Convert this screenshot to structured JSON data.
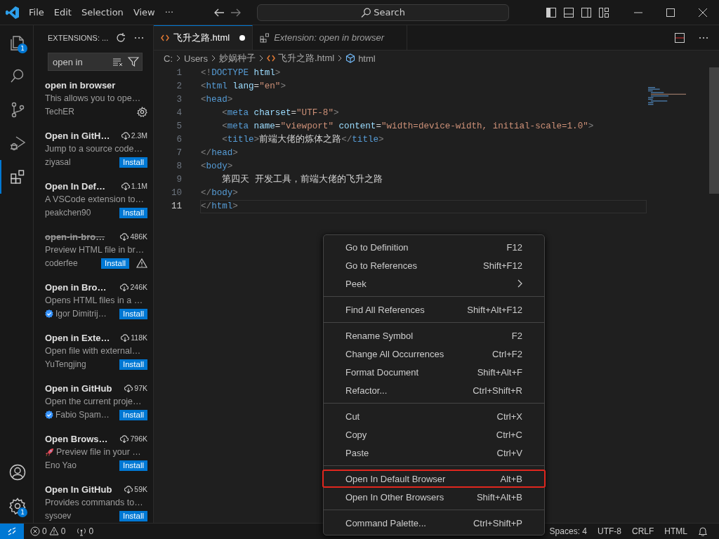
{
  "titlebar": {
    "menu": [
      "File",
      "Edit",
      "Selection",
      "View",
      "···"
    ],
    "search": "Search"
  },
  "activity_bar": {
    "top": [
      {
        "kind": "explorer",
        "selected": false,
        "badge": "1"
      },
      {
        "kind": "search",
        "selected": false
      },
      {
        "kind": "scm",
        "selected": false
      },
      {
        "kind": "run",
        "selected": false
      },
      {
        "kind": "extensions",
        "selected": true
      }
    ],
    "bottom": [
      {
        "kind": "accounts"
      },
      {
        "kind": "manage",
        "badge": "1"
      }
    ]
  },
  "sidebar": {
    "title": "EXTENSIONS: ...",
    "search": {
      "value": "open in"
    },
    "extensions": [
      {
        "name": "open in browser",
        "description": "This allows you to ope…",
        "publisher": "TechER",
        "verified": false,
        "deprecated": false,
        "kind": "installed",
        "warning": false
      },
      {
        "name": "Open in GitH…",
        "downloads": "2.3M",
        "description": "Jump to a source code…",
        "publisher": "ziyasal",
        "verified": false,
        "deprecated": false,
        "kind": "available",
        "action_label": "Install",
        "warning": false
      },
      {
        "name": "Open In Def…",
        "downloads": "1.1M",
        "description": "A VSCode extension to…",
        "publisher": "peakchen90",
        "verified": false,
        "deprecated": false,
        "kind": "available",
        "action_label": "Install",
        "warning": false
      },
      {
        "name": "open-in-bro…",
        "downloads": "486K",
        "description": "Preview HTML file in br…",
        "publisher": "coderfee",
        "verified": false,
        "deprecated": true,
        "kind": "available",
        "action_label": "Install",
        "warning": true
      },
      {
        "name": "Open in Bro…",
        "downloads": "246K",
        "description": "Opens HTML files in a …",
        "publisher": "Igor Dimitrij…",
        "verified": true,
        "deprecated": false,
        "kind": "available",
        "action_label": "Install",
        "warning": false
      },
      {
        "name": "Open in Exte…",
        "downloads": "118K",
        "description": "Open file with external…",
        "publisher": "YuTengjing",
        "verified": false,
        "deprecated": false,
        "kind": "available",
        "action_label": "Install",
        "warning": false
      },
      {
        "name": "Open in GitHub",
        "downloads": "97K",
        "description": "Open the current proje…",
        "publisher": "Fabio Spam…",
        "verified": true,
        "deprecated": false,
        "kind": "available",
        "action_label": "Install",
        "warning": false
      },
      {
        "name": "Open Brows…",
        "downloads": "796K",
        "description": "Preview file in your …",
        "publisher": "Eno Yao",
        "verified": false,
        "deprecated": false,
        "kind": "available",
        "action_label": "Install",
        "warning": false
      },
      {
        "name": "Open In GitHub",
        "downloads": "59K",
        "description": "Provides commands to…",
        "publisher": "sysoev",
        "verified": false,
        "deprecated": false,
        "kind": "available",
        "action_label": "Install",
        "warning": false
      }
    ]
  },
  "tabs": [
    {
      "label": "飞升之路.html",
      "kind": "file",
      "selected": true,
      "modified": true,
      "preview": false
    },
    {
      "label": "Extension: open in browser",
      "kind": "extension",
      "selected": false,
      "modified": false,
      "preview": true
    }
  ],
  "breadcrumb": [
    {
      "label": "C:",
      "kind": "folder"
    },
    {
      "label": "Users",
      "kind": "folder"
    },
    {
      "label": "妙娲种子",
      "kind": "folder"
    },
    {
      "label": "飞升之路.html",
      "kind": "file"
    },
    {
      "label": "html",
      "kind": "element"
    }
  ],
  "code": [
    {
      "number": "1",
      "current": false,
      "tokens": [
        {
          "kind": "punct",
          "text": "<!"
        },
        {
          "kind": "tag",
          "text": "DOCTYPE"
        },
        {
          "kind": "attr",
          "text": " html"
        },
        {
          "kind": "punct",
          "text": ">"
        }
      ]
    },
    {
      "number": "2",
      "current": false,
      "tokens": [
        {
          "kind": "punct",
          "text": "<"
        },
        {
          "kind": "tag",
          "text": "html"
        },
        {
          "kind": "attr",
          "text": " lang"
        },
        {
          "kind": "plain",
          "text": "="
        },
        {
          "kind": "string",
          "text": "\"en\""
        },
        {
          "kind": "punct",
          "text": ">"
        }
      ]
    },
    {
      "number": "3",
      "current": false,
      "tokens": [
        {
          "kind": "punct",
          "text": "<"
        },
        {
          "kind": "tag",
          "text": "head"
        },
        {
          "kind": "punct",
          "text": ">"
        }
      ]
    },
    {
      "number": "4",
      "current": false,
      "tokens": [
        {
          "kind": "punct",
          "text": "    <"
        },
        {
          "kind": "tag",
          "text": "meta"
        },
        {
          "kind": "attr",
          "text": " charset"
        },
        {
          "kind": "plain",
          "text": "="
        },
        {
          "kind": "string",
          "text": "\"UTF-8\""
        },
        {
          "kind": "punct",
          "text": ">"
        }
      ]
    },
    {
      "number": "5",
      "current": false,
      "tokens": [
        {
          "kind": "punct",
          "text": "    <"
        },
        {
          "kind": "tag",
          "text": "meta"
        },
        {
          "kind": "attr",
          "text": " name"
        },
        {
          "kind": "plain",
          "text": "="
        },
        {
          "kind": "string",
          "text": "\"viewport\""
        },
        {
          "kind": "attr",
          "text": " content"
        },
        {
          "kind": "plain",
          "text": "="
        },
        {
          "kind": "string",
          "text": "\"width=device-width, initial-scale=1.0\""
        },
        {
          "kind": "punct",
          "text": ">"
        }
      ]
    },
    {
      "number": "6",
      "current": false,
      "tokens": [
        {
          "kind": "punct",
          "text": "    <"
        },
        {
          "kind": "tag",
          "text": "title"
        },
        {
          "kind": "punct",
          "text": ">"
        },
        {
          "kind": "plain",
          "text": "前端大佬的炼体之路"
        },
        {
          "kind": "punct",
          "text": "</"
        },
        {
          "kind": "tag",
          "text": "title"
        },
        {
          "kind": "punct",
          "text": ">"
        }
      ]
    },
    {
      "number": "7",
      "current": false,
      "tokens": [
        {
          "kind": "punct",
          "text": "</"
        },
        {
          "kind": "tag",
          "text": "head"
        },
        {
          "kind": "punct",
          "text": ">"
        }
      ]
    },
    {
      "number": "8",
      "current": false,
      "tokens": [
        {
          "kind": "punct",
          "text": "<"
        },
        {
          "kind": "tag",
          "text": "body"
        },
        {
          "kind": "punct",
          "text": ">"
        }
      ]
    },
    {
      "number": "9",
      "current": false,
      "tokens": [
        {
          "kind": "plain",
          "text": "    第四天 开发工具，前端大佬的飞升之路"
        }
      ]
    },
    {
      "number": "10",
      "current": false,
      "tokens": [
        {
          "kind": "punct",
          "text": "</"
        },
        {
          "kind": "tag",
          "text": "body"
        },
        {
          "kind": "punct",
          "text": ">"
        }
      ]
    },
    {
      "number": "11",
      "current": true,
      "tokens": [
        {
          "kind": "punct",
          "text": "</"
        },
        {
          "kind": "tag",
          "text": "html"
        },
        {
          "kind": "punct",
          "text": ">"
        }
      ]
    }
  ],
  "context_menu": [
    [
      {
        "label": "Go to Definition",
        "shortcut": "F12",
        "submenu": false,
        "highlighted": false
      },
      {
        "label": "Go to References",
        "shortcut": "Shift+F12",
        "submenu": false,
        "highlighted": false
      },
      {
        "label": "Peek",
        "submenu": true,
        "highlighted": false
      }
    ],
    [
      {
        "label": "Find All References",
        "shortcut": "Shift+Alt+F12",
        "submenu": false,
        "highlighted": false
      }
    ],
    [
      {
        "label": "Rename Symbol",
        "shortcut": "F2",
        "submenu": false,
        "highlighted": false
      },
      {
        "label": "Change All Occurrences",
        "shortcut": "Ctrl+F2",
        "submenu": false,
        "highlighted": false
      },
      {
        "label": "Format Document",
        "shortcut": "Shift+Alt+F",
        "submenu": false,
        "highlighted": false
      },
      {
        "label": "Refactor...",
        "shortcut": "Ctrl+Shift+R",
        "submenu": false,
        "highlighted": false
      }
    ],
    [
      {
        "label": "Cut",
        "shortcut": "Ctrl+X",
        "submenu": false,
        "highlighted": false
      },
      {
        "label": "Copy",
        "shortcut": "Ctrl+C",
        "submenu": false,
        "highlighted": false
      },
      {
        "label": "Paste",
        "shortcut": "Ctrl+V",
        "submenu": false,
        "highlighted": false
      }
    ],
    [
      {
        "label": "Open In Default Browser",
        "shortcut": "Alt+B",
        "submenu": false,
        "highlighted": true
      },
      {
        "label": "Open In Other Browsers",
        "shortcut": "Shift+Alt+B",
        "submenu": false,
        "highlighted": false
      }
    ],
    [
      {
        "label": "Command Palette...",
        "shortcut": "Ctrl+Shift+P",
        "submenu": false,
        "highlighted": false
      }
    ]
  ],
  "status_bar": {
    "errors": "0",
    "warnings": "0",
    "ports": "0",
    "right": [
      "Spaces: 4",
      "UTF-8",
      "CRLF",
      "HTML"
    ]
  }
}
